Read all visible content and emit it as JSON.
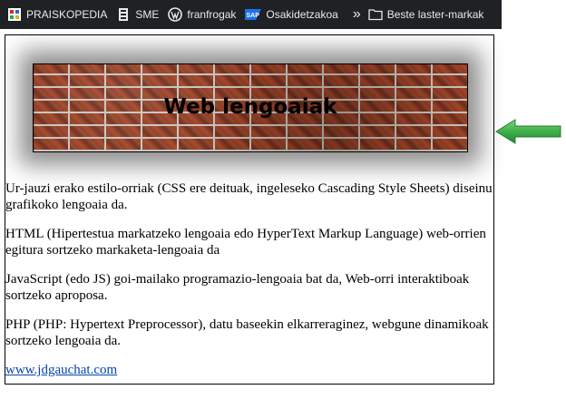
{
  "bookmarks": [
    {
      "label": "PRAISKOPEDIA",
      "icon": "praiskopedia-icon"
    },
    {
      "label": "SME",
      "icon": "sme-icon"
    },
    {
      "label": "franfrogak",
      "icon": "wordpress-icon"
    },
    {
      "label": "Osakidetzakoa",
      "icon": "sap-icon"
    }
  ],
  "bookmarks_overflow": "»",
  "other_bookmarks": "Beste laster-markak",
  "banner_title": "Web lengoaiak",
  "paragraphs": [
    "Ur-jauzi erako estilo-orriak (CSS ere deituak, ingeleseko Cascading Style Sheets) diseinu grafikoko lengoaia da.",
    "HTML (Hipertestua markatzeko lengoaia edo HyperText Markup Language) web-orrien egitura sortzeko markaketa-lengoaia da",
    "JavaScript (edo JS) goi-mailako programazio-lengoaia bat da, Web-orri interaktiboak sortzeko aproposa.",
    "PHP (PHP: Hypertext Preprocessor), datu baseekin elkarreraginez, webgune dinamikoak sortzeko lengoaia da."
  ],
  "link_text": "www.jdgauchat.com",
  "sap_badge": "SAP",
  "colors": {
    "bookmark_bar": "#202124",
    "link": "#0645ad",
    "arrow": "#3fae4a"
  }
}
